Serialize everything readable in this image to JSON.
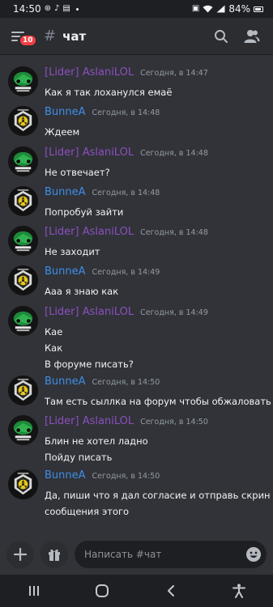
{
  "status_bar": {
    "time": "14:50",
    "battery": "84%"
  },
  "header": {
    "channel_name": "чат",
    "notification_count": "10"
  },
  "messages": [
    {
      "author": "[Lider] AslaniLOL",
      "time": "Сегодня, в 14:47",
      "lines": [
        "Как я так лоханулся емаё"
      ]
    },
    {
      "author": "BunneA",
      "time": "Сегодня, в 14:48",
      "lines": [
        "Ждеем"
      ]
    },
    {
      "author": "[Lider] AslaniLOL",
      "time": "Сегодня, в 14:48",
      "lines": [
        "Не отвечает?"
      ]
    },
    {
      "author": "BunneA",
      "time": "Сегодня, в 14:48",
      "lines": [
        "Попробуй зайти"
      ]
    },
    {
      "author": "[Lider] AslaniLOL",
      "time": "Сегодня, в 14:48",
      "lines": [
        "Не заходит"
      ]
    },
    {
      "author": "BunneA",
      "time": "Сегодня, в 14:49",
      "lines": [
        "Ааа я знаю как"
      ]
    },
    {
      "author": "[Lider] AslaniLOL",
      "time": "Сегодня, в 14:49",
      "lines": [
        "Кае",
        "Как",
        "В форуме писать?"
      ]
    },
    {
      "author": "BunneA",
      "time": "Сегодня, в 14:50",
      "lines": [
        "Там есть сыллка на форум чтобы обжаловать ьан"
      ]
    },
    {
      "author": "[Lider] AslaniLOL",
      "time": "Сегодня, в 14:50",
      "lines": [
        "Блин не хотел ладно",
        "Пойду писать"
      ]
    },
    {
      "author": "BunneA",
      "time": "Сегодня, в 14:50",
      "lines": [
        "Да, пиши что я дал согласие и отправь скрин",
        "сообщения этого"
      ]
    }
  ],
  "composer": {
    "placeholder": "Написать #чат"
  },
  "colors": {
    "lider": "#8c4fc1",
    "bunne": "#3f8ee8",
    "background": "#313338",
    "badge": "#f23f43"
  }
}
